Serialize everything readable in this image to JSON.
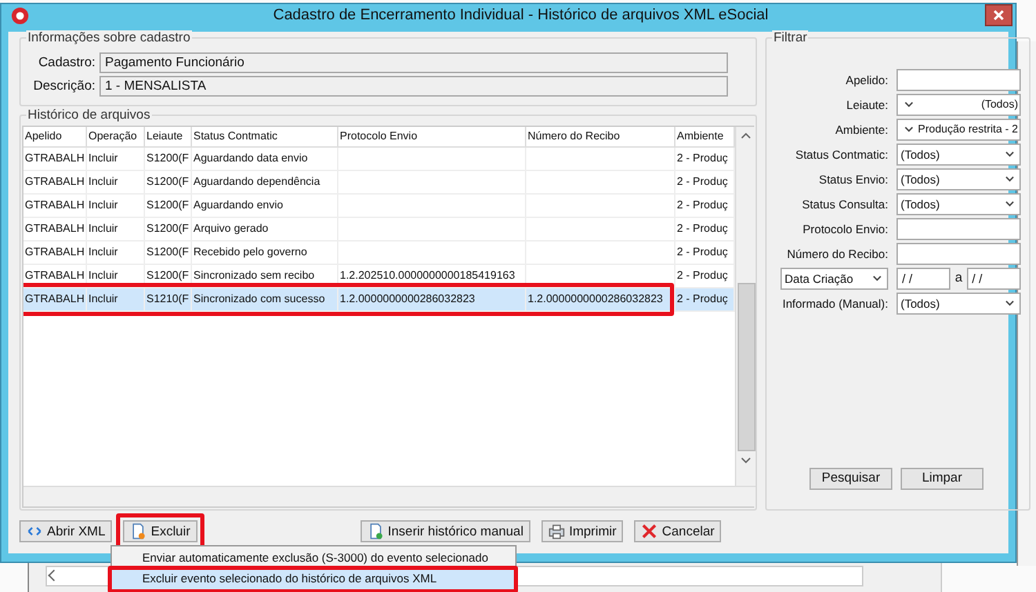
{
  "window": {
    "title": "Cadastro de Encerramento Individual - Histórico de arquivos XML eSocial"
  },
  "cadastro": {
    "title": "Informações sobre cadastro",
    "fields": [
      {
        "label": "Cadastro:",
        "value": "Pagamento Funcionário"
      },
      {
        "label": "Descrição:",
        "value": "1 - MENSALISTA"
      }
    ]
  },
  "history": {
    "title": "Histórico de arquivos",
    "columns": [
      "Apelido",
      "Operação",
      "Leiaute",
      "Status Contmatic",
      "Protocolo Envio",
      "Número do Recibo",
      "Ambiente"
    ],
    "rows": [
      {
        "cells": [
          "GTRABALH",
          "Incluir",
          "S1200(F",
          "Aguardando data envio",
          "",
          "",
          "2 - Produç"
        ],
        "selected": false,
        "highlighted": false
      },
      {
        "cells": [
          "GTRABALH",
          "Incluir",
          "S1200(F",
          "Aguardando dependência",
          "",
          "",
          "2 - Produç"
        ],
        "selected": false,
        "highlighted": false
      },
      {
        "cells": [
          "GTRABALH",
          "Incluir",
          "S1200(F",
          "Aguardando envio",
          "",
          "",
          "2 - Produç"
        ],
        "selected": false,
        "highlighted": false
      },
      {
        "cells": [
          "GTRABALH",
          "Incluir",
          "S1200(F",
          "Arquivo gerado",
          "",
          "",
          "2 - Produç"
        ],
        "selected": false,
        "highlighted": false
      },
      {
        "cells": [
          "GTRABALH",
          "Incluir",
          "S1200(F",
          "Recebido pelo governo",
          "",
          "",
          "2 - Produç"
        ],
        "selected": false,
        "highlighted": false
      },
      {
        "cells": [
          "GTRABALH",
          "Incluir",
          "S1200(F",
          "Sincronizado sem recibo",
          "1.2.202510.0000000000185419163",
          "",
          "2 - Produç"
        ],
        "selected": false,
        "highlighted": false
      },
      {
        "cells": [
          "GTRABALH",
          "Incluir",
          "S1210(F",
          "Sincronizado com sucesso",
          "1.2.0000000000286032823",
          "1.2.0000000000286032823",
          "2 - Produç"
        ],
        "selected": true,
        "highlighted": true
      }
    ]
  },
  "filter": {
    "title": "Filtrar",
    "fields": [
      {
        "kind": "text",
        "label": "Apelido:"
      },
      {
        "kind": "combo_left",
        "label": "Leiaute:",
        "value": "(Todos)"
      },
      {
        "kind": "combo_left",
        "label": "Ambiente:",
        "value": "Produção restrita - 2"
      },
      {
        "kind": "combo",
        "label": "Status Contmatic:",
        "value": "(Todos)"
      },
      {
        "kind": "combo",
        "label": "Status Envio:",
        "value": "(Todos)"
      },
      {
        "kind": "combo",
        "label": "Status Consulta:",
        "value": "(Todos)"
      },
      {
        "kind": "text",
        "label": "Protocolo Envio:"
      },
      {
        "kind": "text",
        "label": "Número do Recibo:"
      },
      {
        "kind": "date_range",
        "label": "Data Criação",
        "from": "/ /",
        "separator": "a",
        "to": "/ /"
      },
      {
        "kind": "combo",
        "label": "Informado (Manual):",
        "value": "(Todos)"
      }
    ],
    "buttons": [
      "Pesquisar",
      "Limpar"
    ]
  },
  "buttons": [
    {
      "kind": "open",
      "label": "Abrir XML",
      "highlighted": false
    },
    {
      "kind": "delete",
      "label": "Excluir",
      "highlighted": true
    },
    {
      "kind": "insert",
      "label": "Inserir histórico manual",
      "highlighted": false
    },
    {
      "kind": "print",
      "label": "Imprimir",
      "highlighted": false
    },
    {
      "kind": "cancel",
      "label": "Cancelar",
      "highlighted": false
    }
  ],
  "menu": {
    "items": [
      {
        "label": "Enviar automaticamente exclusão (S-3000) do evento selecionado",
        "selected": false,
        "highlighted": false
      },
      {
        "label": "Excluir evento selecionado do histórico de arquivos XML",
        "selected": true,
        "highlighted": true
      }
    ]
  }
}
